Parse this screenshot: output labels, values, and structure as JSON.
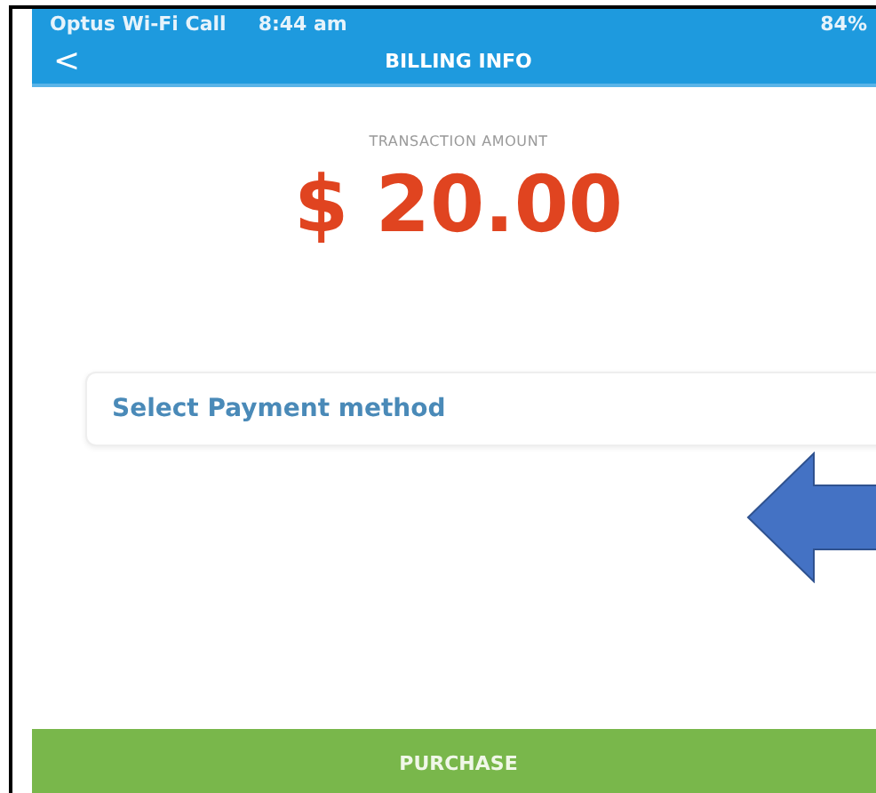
{
  "status_bar": {
    "carrier": "Optus Wi-Fi Call",
    "time": "8:44 am",
    "battery": "84%"
  },
  "nav_bar": {
    "back": "<",
    "title": "BILLING INFO"
  },
  "transaction": {
    "label": "TRANSACTION AMOUNT",
    "amount": "$ 20.00"
  },
  "payment": {
    "placeholder": "Select Payment method"
  },
  "purchase_button": "PURCHASE"
}
